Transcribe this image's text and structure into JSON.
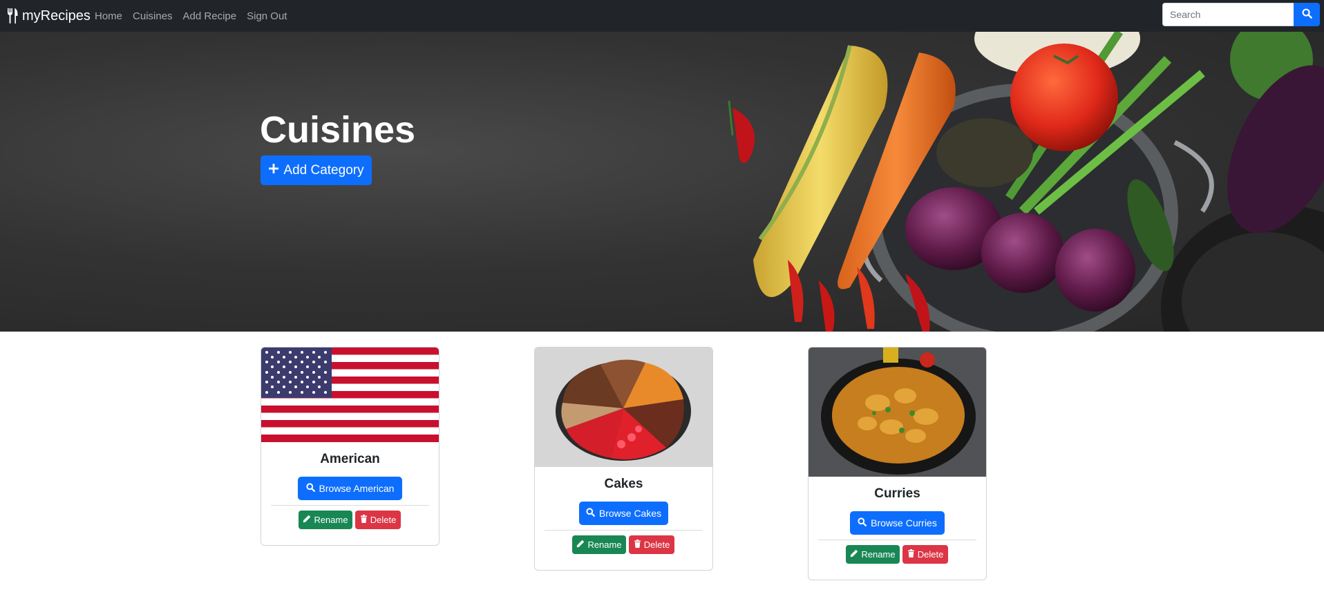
{
  "navbar": {
    "brand": "myRecipes",
    "links": [
      "Home",
      "Cuisines",
      "Add Recipe",
      "Sign Out"
    ],
    "search_placeholder": "Search"
  },
  "hero": {
    "title": "Cuisines",
    "add_button": "Add Category"
  },
  "cards": [
    {
      "name": "American",
      "browse_label": "Browse American",
      "rename_label": "Rename",
      "delete_label": "Delete"
    },
    {
      "name": "Cakes",
      "browse_label": "Browse Cakes",
      "rename_label": "Rename",
      "delete_label": "Delete"
    },
    {
      "name": "Curries",
      "browse_label": "Browse Curries",
      "rename_label": "Rename",
      "delete_label": "Delete"
    }
  ],
  "colors": {
    "navbar_bg": "#212529",
    "primary": "#0d6efd",
    "success": "#198754",
    "danger": "#dc3545"
  },
  "icons": [
    "utensils-icon",
    "search-icon",
    "plus-icon",
    "pencil-icon",
    "trash-icon"
  ]
}
